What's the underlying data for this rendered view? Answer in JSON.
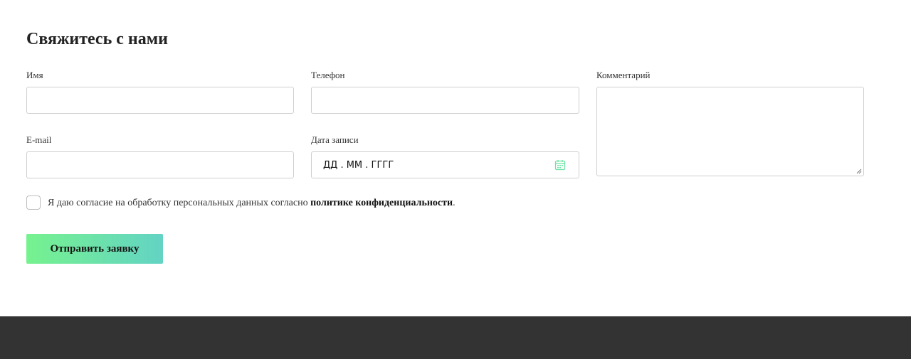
{
  "form": {
    "title": "Свяжитесь с нами",
    "fields": {
      "name": {
        "label": "Имя",
        "value": ""
      },
      "phone": {
        "label": "Телефон",
        "value": ""
      },
      "comment": {
        "label": "Комментарий",
        "value": ""
      },
      "email": {
        "label": "E-mail",
        "value": ""
      },
      "date": {
        "label": "Дата записи",
        "placeholder": "ДД . ММ . ГГГГ",
        "icon": "calendar-icon"
      }
    },
    "consent": {
      "text_before": "Я даю согласие на обработку персональных данных согласно ",
      "link_text": "политике конфиденциальности",
      "text_after": ".",
      "checked": false
    },
    "submit_label": "Отправить заявку"
  },
  "colors": {
    "accent_start": "#76f28f",
    "accent_end": "#63d3c4",
    "icon": "#6fe3a6",
    "footer_bg": "#333333",
    "input_border": "#cfcfcf"
  }
}
